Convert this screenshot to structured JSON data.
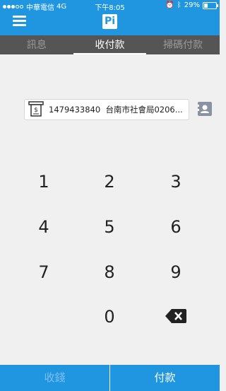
{
  "status_bar": {
    "carrier": "中華電信",
    "network": "4G",
    "time": "下午8:05",
    "battery": "29%"
  },
  "tabs": [
    {
      "label": "訊息"
    },
    {
      "label": "收付款"
    },
    {
      "label": "掃碼付款"
    }
  ],
  "active_tab": "收付款",
  "account": {
    "number": "1479433840",
    "name": "台南市社會局0206..."
  },
  "keypad": {
    "keys": [
      "1",
      "2",
      "3",
      "4",
      "5",
      "6",
      "7",
      "8",
      "9",
      "0"
    ]
  },
  "bottom": {
    "collect_label": "收錢",
    "pay_label": "付款"
  },
  "colors": {
    "primary": "#2196e0",
    "tab_bar": "#555555",
    "background": "#f0f0f0"
  },
  "icons": [
    "menu-icon",
    "app-logo-icon",
    "receipt-icon",
    "contacts-icon",
    "backspace-icon",
    "alarm-icon",
    "bluetooth-icon",
    "battery-icon"
  ]
}
